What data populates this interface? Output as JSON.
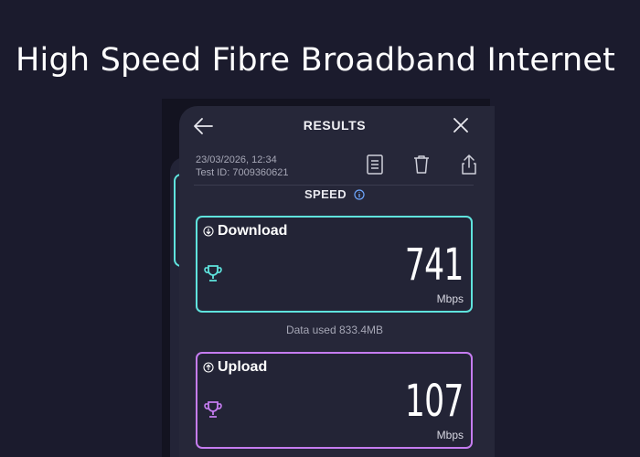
{
  "headline": "High Speed Fibre Broadband Internet",
  "header": {
    "title": "RESULTS",
    "back_icon": "arrow-left-icon",
    "close_icon": "close-icon"
  },
  "meta": {
    "datetime": "23/03/2026, 12:34",
    "test_id": "Test ID: 7009360621"
  },
  "actions": {
    "report_icon": "document-icon",
    "delete_icon": "trash-icon",
    "share_icon": "share-icon"
  },
  "section": {
    "title": "SPEED",
    "info_icon": "info-icon"
  },
  "download": {
    "label": "Download",
    "value": "741",
    "unit": "Mbps",
    "icon": "download-arrow-icon",
    "trophy_icon": "trophy-icon",
    "accent": "#5fe3dd"
  },
  "data_used": "Data used 833.4MB",
  "upload": {
    "label": "Upload",
    "value": "107",
    "unit": "Mbps",
    "icon": "upload-arrow-icon",
    "trophy_icon": "trophy-icon",
    "accent": "#c57cf0"
  },
  "colors": {
    "background": "#1b1b2d",
    "panel": "#262739",
    "text_muted": "#a6a7b6"
  }
}
